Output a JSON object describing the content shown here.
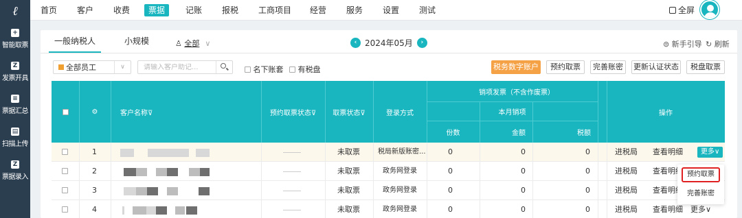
{
  "logo": "ℓ",
  "leftnav": [
    {
      "label": "智能取票",
      "icon": "plus-square-icon"
    },
    {
      "label": "发票开具",
      "icon": "invoice-icon"
    },
    {
      "label": "票据汇总",
      "icon": "summary-icon"
    },
    {
      "label": "扫描上传",
      "icon": "scanner-icon"
    },
    {
      "label": "票据录入",
      "icon": "entry-icon"
    }
  ],
  "topnav": {
    "items": [
      "首页",
      "客户",
      "收费",
      "票据",
      "记账",
      "报税",
      "工商项目",
      "经营",
      "服务",
      "设置",
      "测试"
    ],
    "active_index": 3,
    "fullscreen": "全屏"
  },
  "tabs": [
    "一般纳税人",
    "小规模"
  ],
  "filter_all": "全部",
  "month": "2024年05月",
  "guide": "新手引导",
  "refresh": "刷新",
  "employee_select": "全部员工",
  "search_placeholder": "请输入客户助记...",
  "checkbox_labels": [
    "名下账套",
    "有税盘"
  ],
  "action_buttons": [
    "税务数字账户",
    "预约取票",
    "完善账密",
    "更新认证状态",
    "税盘取票"
  ],
  "table": {
    "headers": {
      "customer": "客户名称⊽",
      "reserve_status": "预约取票状态⊽",
      "fetch_status": "取票状态⊽",
      "login": "登录方式",
      "sales_group": "销项发票（不含作废票）",
      "month_sales": "本月销项",
      "count": "份数",
      "amount": "金额",
      "tax": "税额",
      "ops": "操作"
    },
    "rows": [
      {
        "idx": "1",
        "status": "未取票",
        "login": "税局新版账密...",
        "count": "0",
        "amount": "0",
        "tax": "0",
        "op1": "进税局",
        "op2": "查看明细",
        "op3": "更多∨"
      },
      {
        "idx": "2",
        "status": "未取票",
        "login": "政务网登录",
        "count": "0",
        "amount": "0",
        "tax": "0",
        "op1": "进税局",
        "op2": "查看明细",
        "op3": ""
      },
      {
        "idx": "3",
        "status": "未取票",
        "login": "政务网登录",
        "count": "0",
        "amount": "0",
        "tax": "0",
        "op1": "进税局",
        "op2": "查看明细",
        "op3": ""
      },
      {
        "idx": "4",
        "status": "未取票",
        "login": "政务网登录",
        "count": "0",
        "amount": "0",
        "tax": "0",
        "op1": "进税局",
        "op2": "查看明细",
        "op3": "更多∨"
      }
    ]
  },
  "dropdown": [
    "预约取票",
    "完善账密"
  ],
  "colors": {
    "accent": "#19b6c0",
    "primary_button": "#f5a145",
    "highlight_border": "#e02020",
    "nav_bg": "#2b3e4f"
  }
}
